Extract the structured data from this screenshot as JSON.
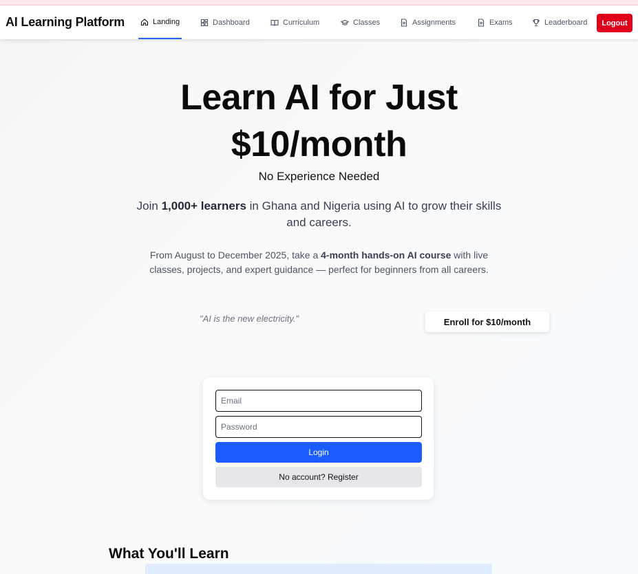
{
  "nav": {
    "brand": "AI Learning Platform",
    "items": [
      {
        "label": "Landing",
        "icon": "home-icon",
        "active": true
      },
      {
        "label": "Dashboard",
        "icon": "dashboard-icon",
        "active": false
      },
      {
        "label": "Curriculum",
        "icon": "book-icon",
        "active": false
      },
      {
        "label": "Classes",
        "icon": "graduation-cap-icon",
        "active": false
      },
      {
        "label": "Assignments",
        "icon": "document-icon",
        "active": false
      },
      {
        "label": "Exams",
        "icon": "document-icon",
        "active": false
      },
      {
        "label": "Leaderboard",
        "icon": "trophy-icon",
        "active": false
      }
    ],
    "logout_label": "Logout"
  },
  "hero": {
    "title_line1": "Learn AI for Just",
    "title_line2": "$10/month",
    "subtitle": "No Experience Needed",
    "desc_prefix": "Join ",
    "desc_bold": "1,000+ learners",
    "desc_suffix": " in Ghana and Nigeria using AI to grow their skills and careers.",
    "detail_prefix": "From August to December 2025, take a ",
    "detail_bold": "4-month hands-on AI course",
    "detail_suffix": " with live classes, projects, and expert guidance — perfect for beginners from all careers.",
    "quote": "\"AI is the new electricity.\"",
    "enroll_label": "Enroll for $10/month"
  },
  "login": {
    "email_placeholder": "Email",
    "email_value": "",
    "password_placeholder": "Password",
    "password_value": "",
    "login_label": "Login",
    "register_label": "No account? Register"
  },
  "section": {
    "title": "What You'll Learn"
  },
  "colors": {
    "accent": "#1a5cff",
    "logout": "#e0001b",
    "active_underline": "#2563eb"
  }
}
